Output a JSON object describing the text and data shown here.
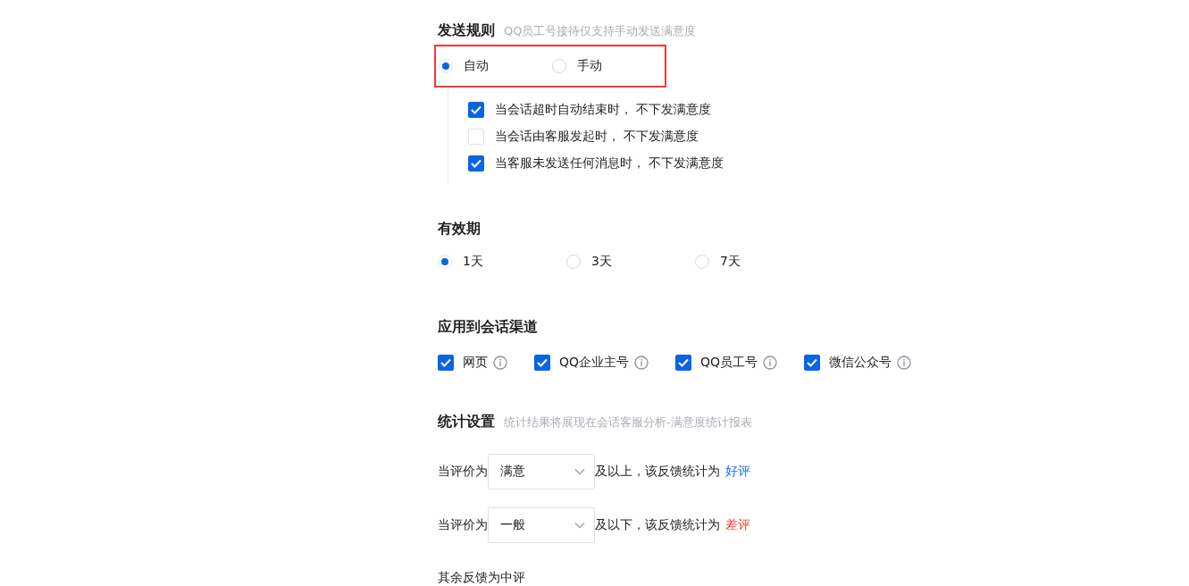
{
  "send_rule": {
    "title": "发送规则",
    "hint": "QQ员工号接待仅支持手动发送满意度",
    "highlighted": true,
    "options": [
      {
        "label": "自动",
        "selected": true
      },
      {
        "label": "手动",
        "selected": false
      }
    ],
    "conditions": [
      {
        "label": "当会话超时自动结束时， 不下发满意度",
        "checked": true
      },
      {
        "label": "当会话由客服发起时， 不下发满意度",
        "checked": false
      },
      {
        "label": "当客服未发送任何消息时， 不下发满意度",
        "checked": true
      }
    ]
  },
  "validity": {
    "title": "有效期",
    "options": [
      {
        "label": "1天",
        "selected": true
      },
      {
        "label": "3天",
        "selected": false
      },
      {
        "label": "7天",
        "selected": false
      }
    ]
  },
  "channels": {
    "title": "应用到会话渠道",
    "items": [
      {
        "label": "网页",
        "checked": true
      },
      {
        "label": "QQ企业主号",
        "checked": true
      },
      {
        "label": "QQ员工号",
        "checked": true
      },
      {
        "label": "微信公众号",
        "checked": true
      }
    ]
  },
  "statistics": {
    "title": "统计设置",
    "hint": "统计结果将展现在会话客服分析-满意度统计报表",
    "rules": [
      {
        "prefix": "当评价为",
        "value": "满意",
        "suffix": "及以上，该反馈统计为",
        "result": "好评",
        "color": "#1a6cf0"
      },
      {
        "prefix": "当评价为",
        "value": "一般",
        "suffix": "及以下，该反馈统计为",
        "result": "差评",
        "color": "#f5402f"
      }
    ],
    "note": "其余反馈为中评"
  }
}
